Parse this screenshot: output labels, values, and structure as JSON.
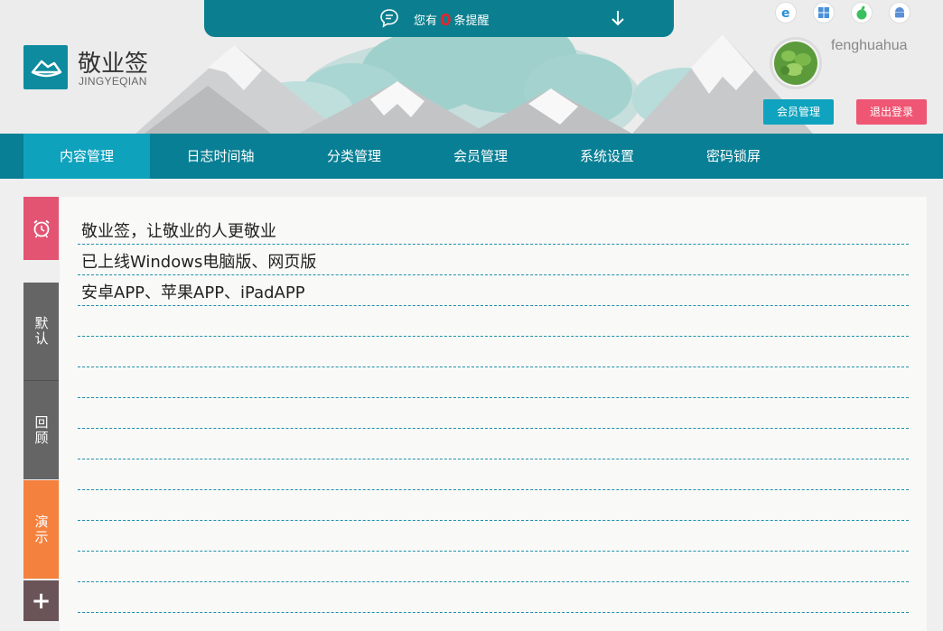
{
  "notice": {
    "prefix": "您有",
    "count": "0",
    "suffix": "条提醒"
  },
  "brand": {
    "name": "敬业签",
    "sub": "JINGYEQIAN"
  },
  "platforms": [
    "ie-icon",
    "windows-icon",
    "apple-icon",
    "android-icon"
  ],
  "user": {
    "name": "fenghuahua",
    "member_button": "会员管理",
    "logout_button": "退出登录"
  },
  "nav": {
    "items": [
      {
        "label": "内容管理",
        "active": true
      },
      {
        "label": "日志时间轴"
      },
      {
        "label": "分类管理"
      },
      {
        "label": "会员管理"
      },
      {
        "label": "系统设置"
      },
      {
        "label": "密码锁屏"
      }
    ]
  },
  "side": {
    "tabs": [
      {
        "label": "默认"
      },
      {
        "label": "回顾"
      },
      {
        "label": "演示"
      }
    ],
    "add_label": "+"
  },
  "notes": {
    "lines": [
      "敬业签，让敬业的人更敬业",
      "已上线Windows电脑版、网页版",
      "安卓APP、苹果APP、iPadAPP",
      "",
      "",
      "",
      "",
      "",
      "",
      "",
      "",
      "",
      ""
    ]
  },
  "colors": {
    "teal_dark": "#087f94",
    "teal_active": "#0fa2bd",
    "pink": "#e35473",
    "orange": "#f4813d",
    "gray": "#656565",
    "logout": "#ef5673"
  }
}
